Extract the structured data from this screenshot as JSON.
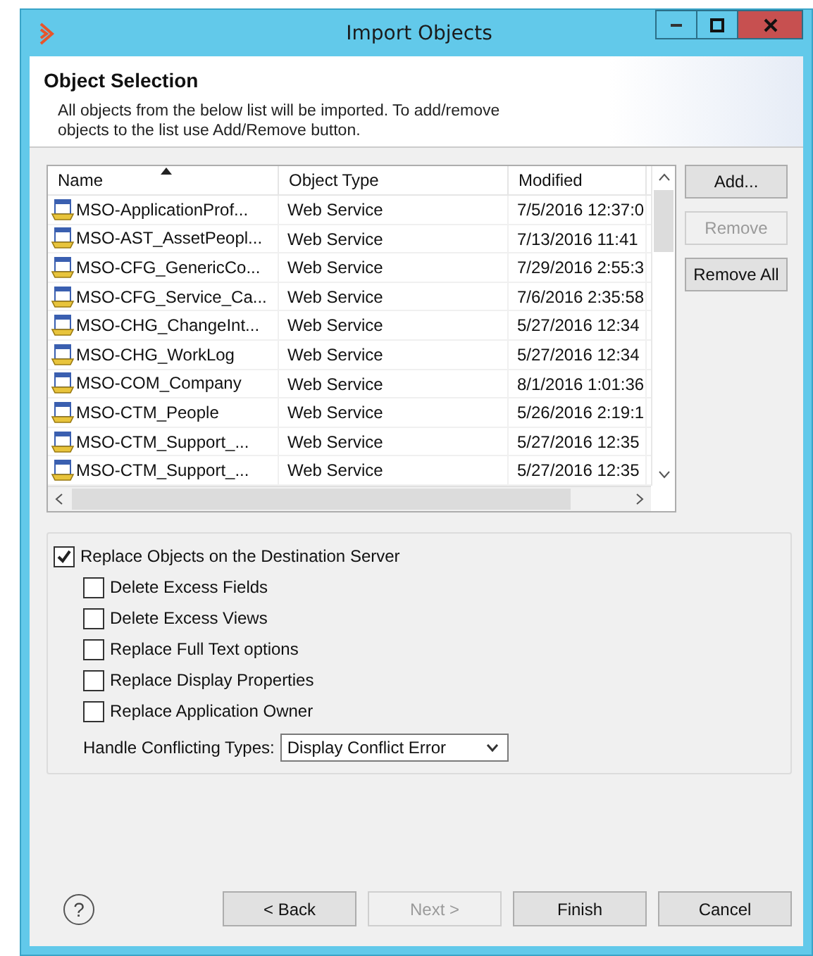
{
  "window": {
    "title": "Import Objects"
  },
  "header": {
    "title": "Object Selection",
    "description": "All objects from the below list will be imported. To add/remove objects to the list use Add/Remove button."
  },
  "table": {
    "columns": [
      {
        "label": "Name",
        "sorted": true
      },
      {
        "label": "Object Type",
        "sorted": false
      },
      {
        "label": "Modified",
        "sorted": false
      }
    ],
    "rows": [
      {
        "name": "MSO-ApplicationProf...",
        "type": "Web Service",
        "modified": "7/5/2016 12:37:0"
      },
      {
        "name": "MSO-AST_AssetPeopl...",
        "type": "Web Service",
        "modified": "7/13/2016 11:41"
      },
      {
        "name": "MSO-CFG_GenericCo...",
        "type": "Web Service",
        "modified": "7/29/2016 2:55:3"
      },
      {
        "name": "MSO-CFG_Service_Ca...",
        "type": "Web Service",
        "modified": "7/6/2016 2:35:58"
      },
      {
        "name": "MSO-CHG_ChangeInt...",
        "type": "Web Service",
        "modified": "5/27/2016 12:34"
      },
      {
        "name": "MSO-CHG_WorkLog",
        "type": "Web Service",
        "modified": "5/27/2016 12:34"
      },
      {
        "name": "MSO-COM_Company",
        "type": "Web Service",
        "modified": "8/1/2016 1:01:36"
      },
      {
        "name": "MSO-CTM_People",
        "type": "Web Service",
        "modified": "5/26/2016 2:19:1"
      },
      {
        "name": "MSO-CTM_Support_...",
        "type": "Web Service",
        "modified": "5/27/2016 12:35"
      },
      {
        "name": "MSO-CTM_Support_...",
        "type": "Web Service",
        "modified": "5/27/2016 12:35"
      }
    ]
  },
  "side_buttons": [
    {
      "label": "Add...",
      "disabled": false
    },
    {
      "label": "Remove",
      "disabled": true
    },
    {
      "label": "Remove All",
      "disabled": false
    }
  ],
  "options": {
    "replace": {
      "label": "Replace Objects on the Destination Server",
      "checked": true
    },
    "sub_options": [
      {
        "label": "Delete Excess Fields",
        "checked": false
      },
      {
        "label": "Delete Excess Views",
        "checked": false
      },
      {
        "label": "Replace Full Text options",
        "checked": false
      },
      {
        "label": "Replace Display Properties",
        "checked": false
      },
      {
        "label": "Replace Application Owner",
        "checked": false
      }
    ],
    "conflict": {
      "label": "Handle Conflicting Types:",
      "value": "Display Conflict Error"
    }
  },
  "footer": {
    "help": "?",
    "buttons": [
      {
        "label": "< Back",
        "disabled": false
      },
      {
        "label": "Next >",
        "disabled": true
      },
      {
        "label": "Finish",
        "disabled": false
      },
      {
        "label": "Cancel",
        "disabled": false
      }
    ]
  }
}
